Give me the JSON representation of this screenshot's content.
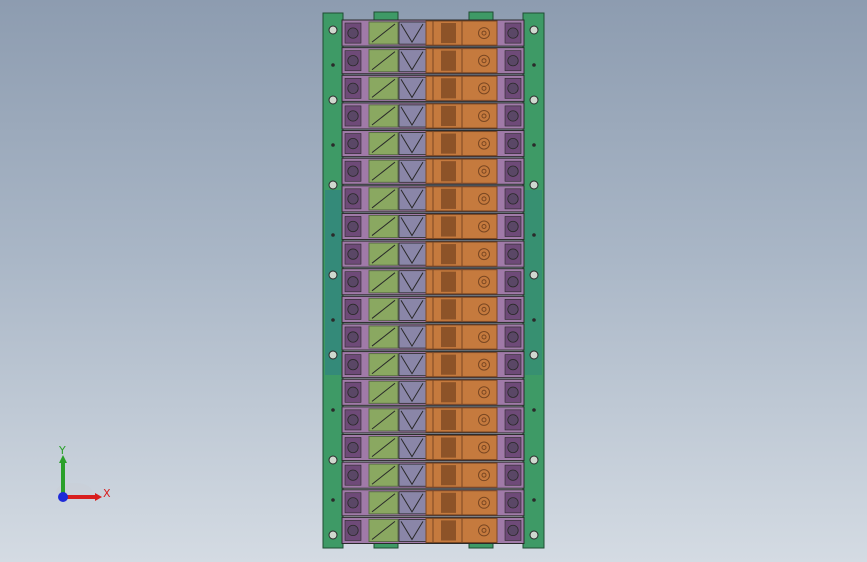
{
  "viewport": {
    "background_top": "#8d9cb0",
    "background_bottom": "#d4dbe3"
  },
  "model": {
    "module_count": 19,
    "colors": {
      "rail": "#3e9a66",
      "rail_edge": "#1f4d33",
      "base_plate": "#2c7e88",
      "terminal": "#a07aa8",
      "terminal_dark": "#6e4a78",
      "screw": "#5a4766",
      "clamp": "#8aa861",
      "clamp_dark": "#5a6e45",
      "cage": "#8a86a8",
      "contact": "#c57a3e",
      "contact_dark": "#7a4722",
      "outline": "#2a2a2a"
    }
  },
  "triad": {
    "x_label": "X",
    "y_label": "Y",
    "x_color": "#d81e1e",
    "y_color": "#2aa02a",
    "z_color": "#1e2ad8"
  }
}
